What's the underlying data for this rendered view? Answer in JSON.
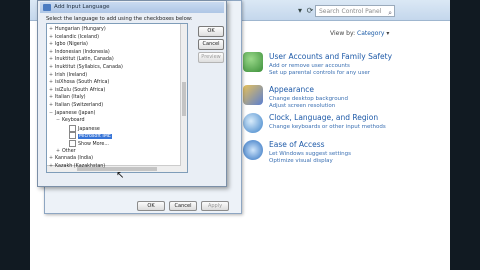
{
  "control_panel": {
    "search_placeholder": "Search Control Panel",
    "view_by_label": "View by:",
    "view_by_value": "Category",
    "categories": [
      {
        "title": "User Accounts and Family Safety",
        "links": [
          "Add or remove user accounts",
          "Set up parental controls for any user"
        ],
        "color": "#3c8f3a"
      },
      {
        "title": "Appearance",
        "links": [
          "Change desktop background",
          "Adjust screen resolution"
        ],
        "color": "#5b7fd0"
      },
      {
        "title": "Clock, Language, and Region",
        "links": [
          "Change keyboards or other input methods"
        ],
        "color": "#3a80c8"
      },
      {
        "title": "Ease of Access",
        "links": [
          "Let Windows suggest settings",
          "Optimize visual display"
        ],
        "color": "#2c6fbf"
      }
    ]
  },
  "background_dialog": {
    "ok": "OK",
    "cancel": "Cancel",
    "apply": "Apply"
  },
  "add_input_language": {
    "title": "Add Input Language",
    "instruction": "Select the language to add using the checkboxes below:",
    "ok": "OK",
    "cancel": "Cancel",
    "preview": "Preview",
    "tree": [
      {
        "label": "Hungarian (Hungary)",
        "indent": 1,
        "exp": "+",
        "chk": false,
        "sel": false
      },
      {
        "label": "Icelandic (Iceland)",
        "indent": 1,
        "exp": "+",
        "chk": false,
        "sel": false
      },
      {
        "label": "Igbo (Nigeria)",
        "indent": 1,
        "exp": "+",
        "chk": false,
        "sel": false
      },
      {
        "label": "Indonesian (Indonesia)",
        "indent": 1,
        "exp": "+",
        "chk": false,
        "sel": false
      },
      {
        "label": "Inuktitut (Latin, Canada)",
        "indent": 1,
        "exp": "+",
        "chk": false,
        "sel": false
      },
      {
        "label": "Inuktitut (Syllabics, Canada)",
        "indent": 1,
        "exp": "+",
        "chk": false,
        "sel": false
      },
      {
        "label": "Irish (Ireland)",
        "indent": 1,
        "exp": "+",
        "chk": false,
        "sel": false
      },
      {
        "label": "isiXhosa (South Africa)",
        "indent": 1,
        "exp": "+",
        "chk": false,
        "sel": false
      },
      {
        "label": "isiZulu (South Africa)",
        "indent": 1,
        "exp": "+",
        "chk": false,
        "sel": false
      },
      {
        "label": "Italian (Italy)",
        "indent": 1,
        "exp": "+",
        "chk": false,
        "sel": false
      },
      {
        "label": "Italian (Switzerland)",
        "indent": 1,
        "exp": "+",
        "chk": false,
        "sel": false
      },
      {
        "label": "Japanese (Japan)",
        "indent": 1,
        "exp": "−",
        "chk": false,
        "sel": false
      },
      {
        "label": "Keyboard",
        "indent": 2,
        "exp": "−",
        "chk": false,
        "sel": false
      },
      {
        "label": "Japanese",
        "indent": 3,
        "exp": "",
        "chk": true,
        "sel": false
      },
      {
        "label": "Microsoft IME",
        "indent": 3,
        "exp": "",
        "chk": true,
        "sel": true
      },
      {
        "label": "Show More...",
        "indent": 3,
        "exp": "",
        "chk": true,
        "sel": false
      },
      {
        "label": "Other",
        "indent": 2,
        "exp": "+",
        "chk": false,
        "sel": false
      },
      {
        "label": "Kannada (India)",
        "indent": 1,
        "exp": "+",
        "chk": false,
        "sel": false
      },
      {
        "label": "Kazakh (Kazakhstan)",
        "indent": 1,
        "exp": "+",
        "chk": false,
        "sel": false
      }
    ]
  }
}
